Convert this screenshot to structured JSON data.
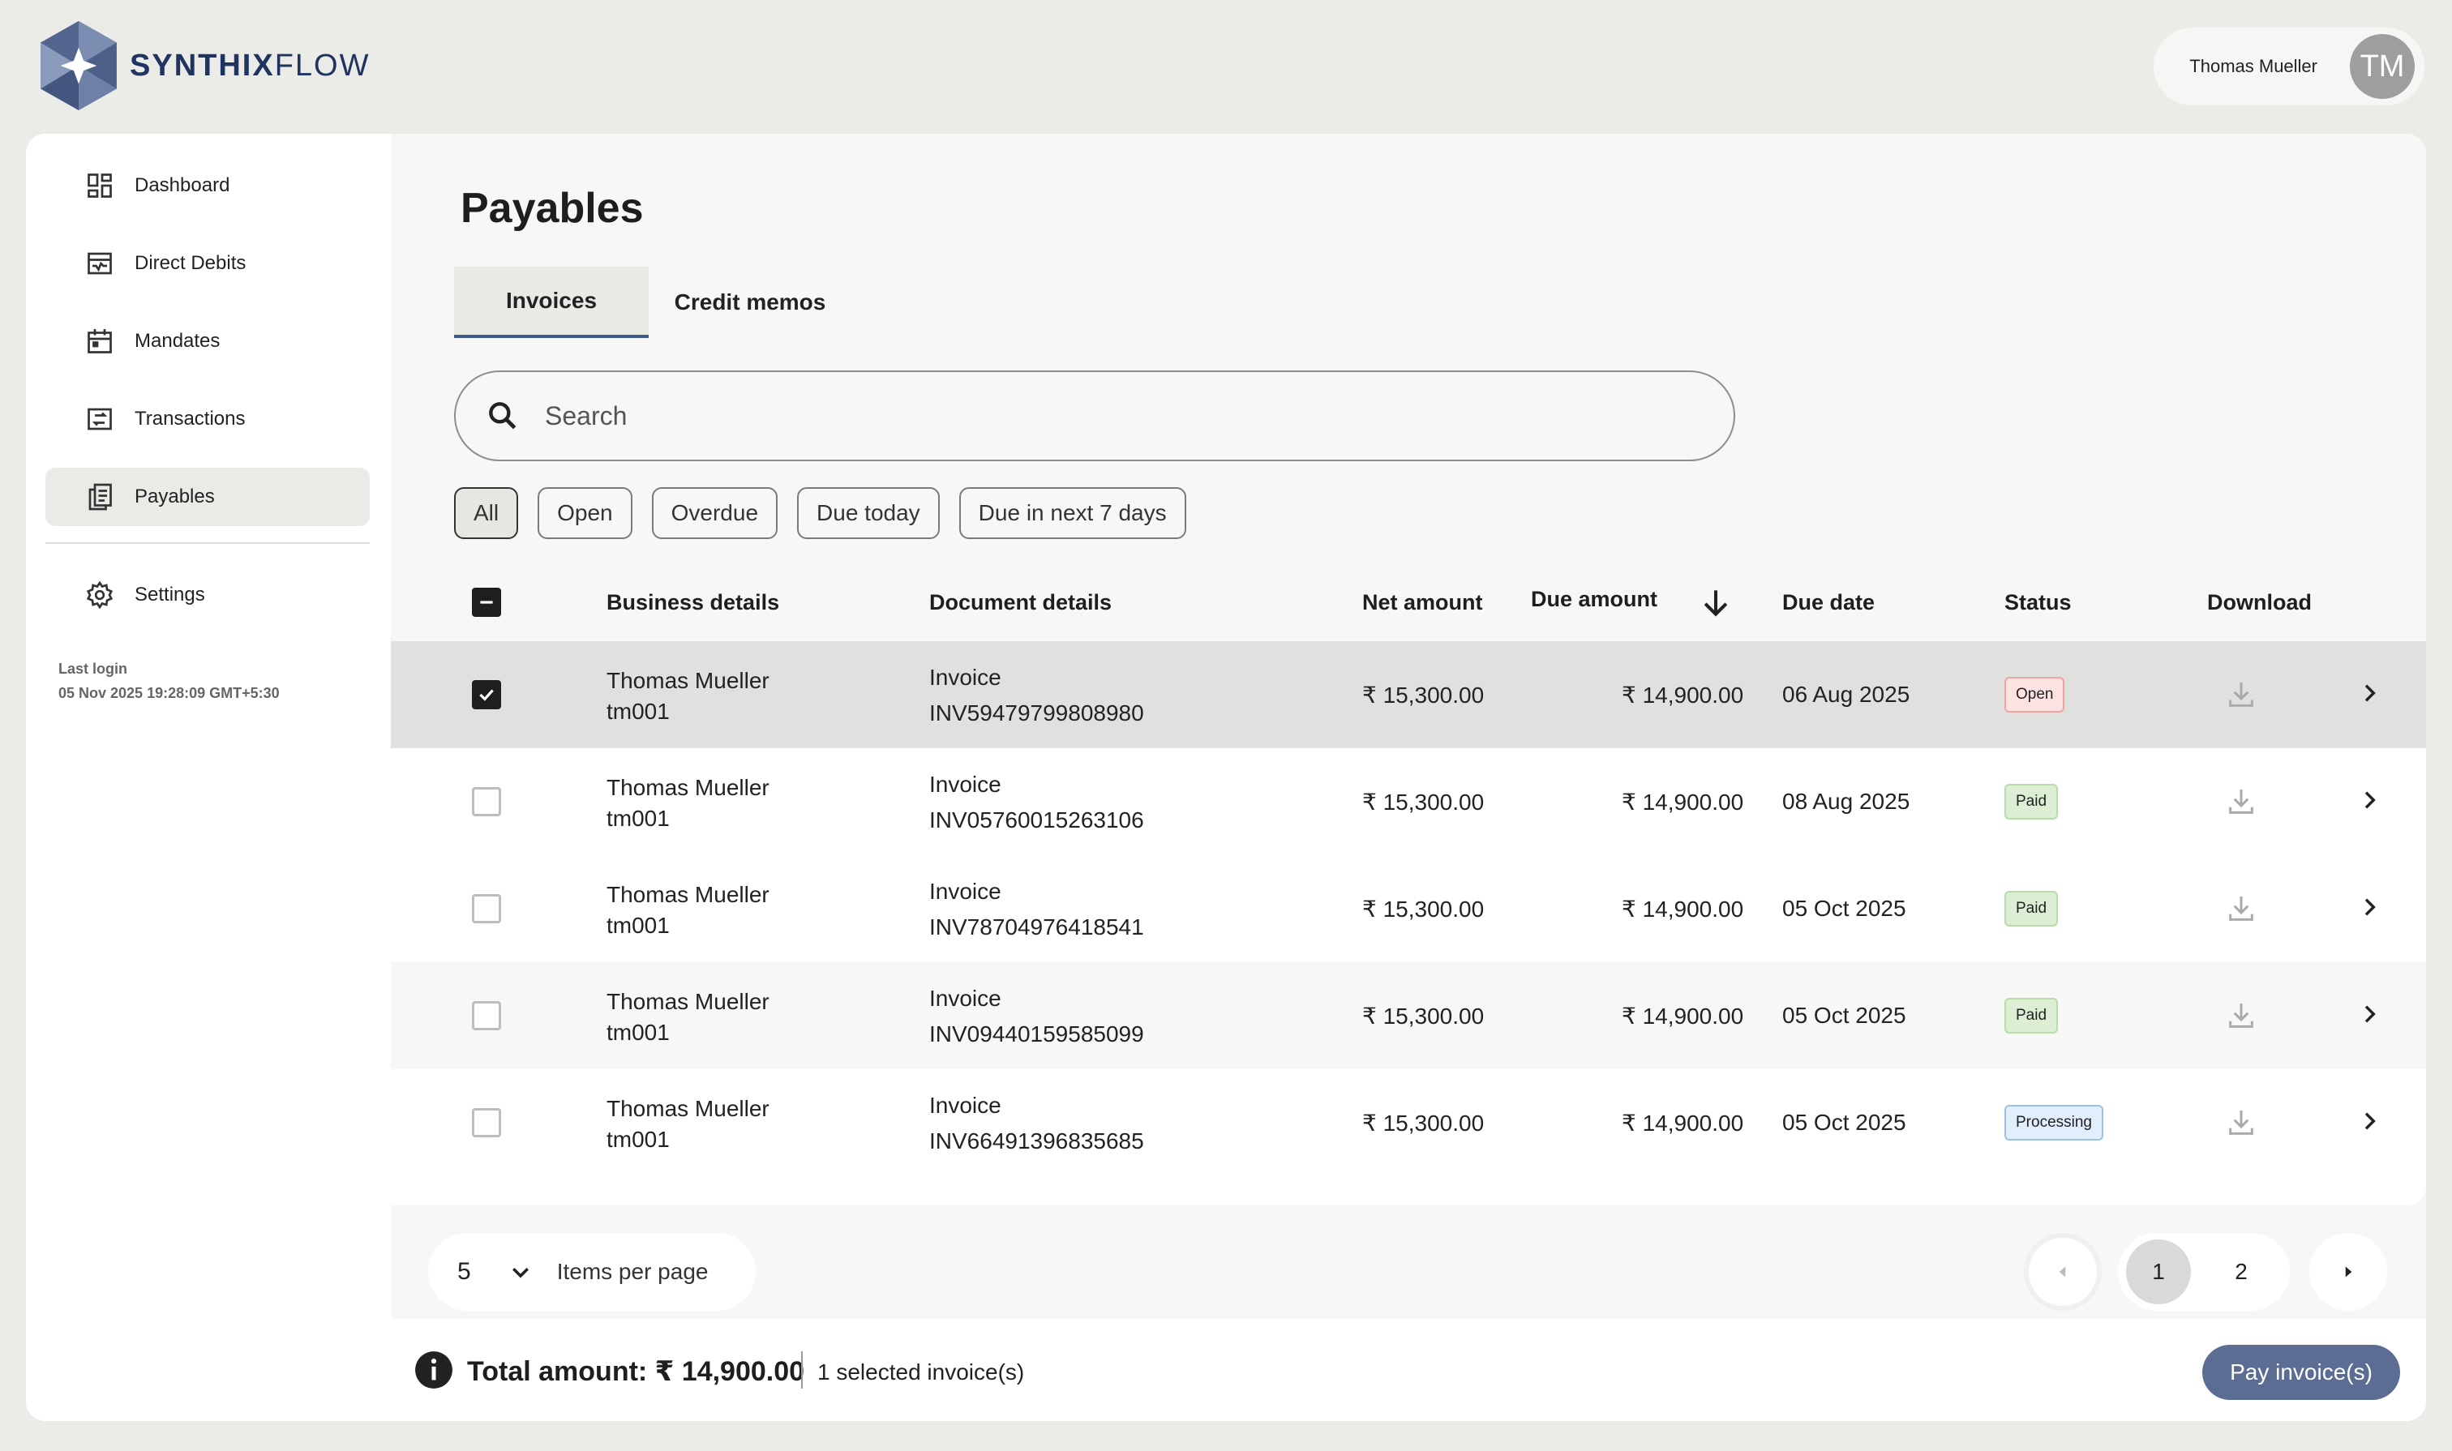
{
  "brand": {
    "name_bold": "SYNTHIX",
    "name_light": "FLOW"
  },
  "user": {
    "name": "Thomas Mueller",
    "initials": "TM"
  },
  "sidebar": {
    "items": [
      {
        "label": "Dashboard",
        "icon": "dashboard-icon"
      },
      {
        "label": "Direct Debits",
        "icon": "direct-debits-icon"
      },
      {
        "label": "Mandates",
        "icon": "calendar-icon"
      },
      {
        "label": "Transactions",
        "icon": "transfer-icon"
      },
      {
        "label": "Payables",
        "icon": "documents-icon",
        "active": true
      },
      {
        "label": "Settings",
        "icon": "gear-icon"
      }
    ],
    "last_login_label": "Last login",
    "last_login_value": "05 Nov 2025 19:28:09 GMT+5:30"
  },
  "page": {
    "title": "Payables"
  },
  "tabs": [
    {
      "label": "Invoices",
      "active": true
    },
    {
      "label": "Credit memos"
    }
  ],
  "search": {
    "placeholder": "Search"
  },
  "filters": [
    "All",
    "Open",
    "Overdue",
    "Due today",
    "Due in next 7 days"
  ],
  "table": {
    "headers": {
      "business": "Business details",
      "document": "Document details",
      "net": "Net amount",
      "due": "Due amount",
      "date": "Due date",
      "status": "Status",
      "download": "Download"
    },
    "rows": [
      {
        "name": "Thomas Mueller",
        "id": "tm001",
        "doc_type": "Invoice",
        "doc_no": "INV59479799808980",
        "net": "₹ 15,300.00",
        "due": "₹ 14,900.00",
        "date": "06 Aug 2025",
        "status": "Open",
        "checked": true
      },
      {
        "name": "Thomas Mueller",
        "id": "tm001",
        "doc_type": "Invoice",
        "doc_no": "INV05760015263106",
        "net": "₹ 15,300.00",
        "due": "₹ 14,900.00",
        "date": "08 Aug 2025",
        "status": "Paid",
        "checked": false
      },
      {
        "name": "Thomas Mueller",
        "id": "tm001",
        "doc_type": "Invoice",
        "doc_no": "INV78704976418541",
        "net": "₹ 15,300.00",
        "due": "₹ 14,900.00",
        "date": "05 Oct 2025",
        "status": "Paid",
        "checked": false
      },
      {
        "name": "Thomas Mueller",
        "id": "tm001",
        "doc_type": "Invoice",
        "doc_no": "INV09440159585099",
        "net": "₹ 15,300.00",
        "due": "₹ 14,900.00",
        "date": "05 Oct 2025",
        "status": "Paid",
        "checked": false
      },
      {
        "name": "Thomas Mueller",
        "id": "tm001",
        "doc_type": "Invoice",
        "doc_no": "INV66491396835685",
        "net": "₹ 15,300.00",
        "due": "₹ 14,900.00",
        "date": "05 Oct 2025",
        "status": "Processing",
        "checked": false
      }
    ]
  },
  "pagination": {
    "per_page": "5",
    "per_page_label": "Items per page",
    "pages": [
      "1",
      "2"
    ],
    "current": "1"
  },
  "footer": {
    "total": "Total amount: ₹ 14,900.00",
    "selected": "1 selected invoice(s)",
    "pay_label": "Pay invoice(s)"
  },
  "colors": {
    "brand": "#1f3460",
    "accent": "#3e5a8c",
    "pay_button": "#5b6d92"
  }
}
